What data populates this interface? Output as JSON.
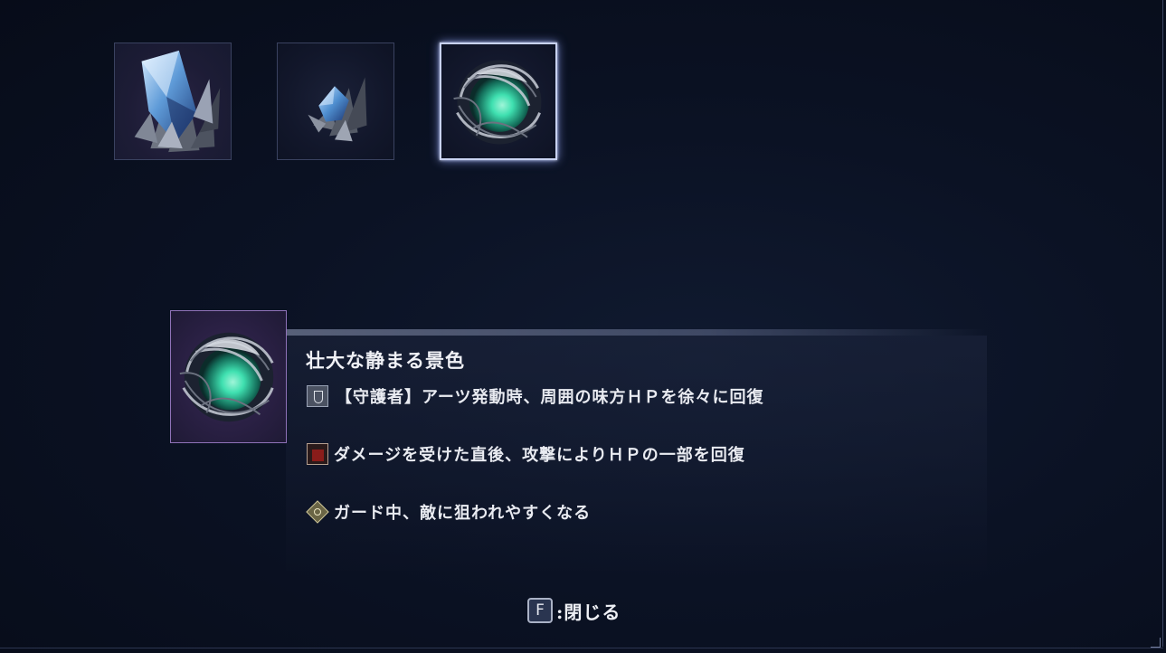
{
  "equipment_slots": [
    {
      "icon": "large-crystal-icon",
      "selected": false
    },
    {
      "icon": "small-crystal-icon",
      "selected": false
    },
    {
      "icon": "vine-orb-icon",
      "selected": true
    }
  ],
  "detail": {
    "icon": "vine-orb-icon",
    "title": "壮大な静まる景色",
    "effects": [
      {
        "icon": "guardian-icon",
        "text": "【守護者】アーツ発動時、周囲の味方ＨＰを徐々に回復"
      },
      {
        "icon": "damage-icon",
        "text": "ダメージを受けた直後、攻撃によりＨＰの一部を回復"
      },
      {
        "icon": "guard-icon",
        "text": "ガード中、敵に狙われやすくなる"
      }
    ]
  },
  "close_hint": {
    "key": "F",
    "label": ":閉じる"
  },
  "colors": {
    "selection_glow": "#c8d2f0",
    "detail_icon_border": "#8f72b8",
    "orb_glow": "#3fe0b0"
  }
}
